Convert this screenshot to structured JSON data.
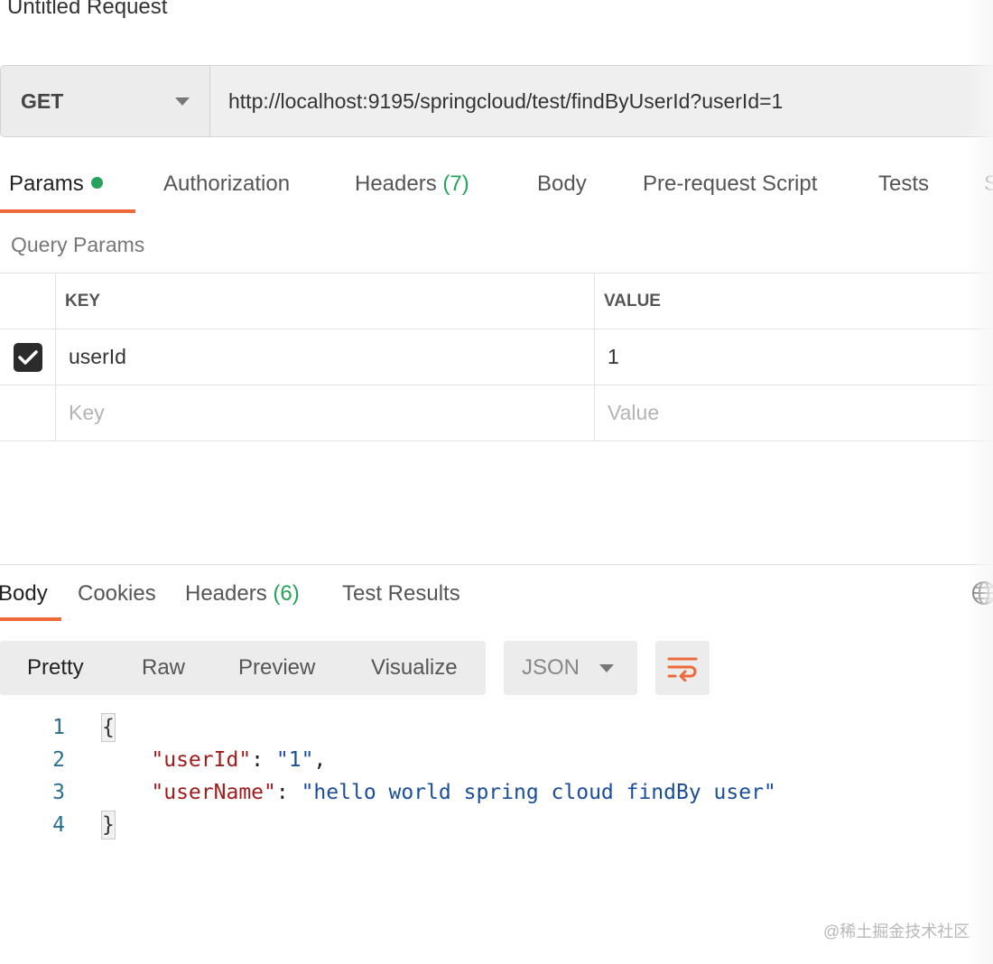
{
  "request": {
    "title": "Untitled Request",
    "method": "GET",
    "url": "http://localhost:9195/springcloud/test/findByUserId?userId=1"
  },
  "request_tabs": [
    {
      "label": "Params",
      "active": true,
      "has_dot": true
    },
    {
      "label": "Authorization"
    },
    {
      "label": "Headers",
      "count": "(7)"
    },
    {
      "label": "Body"
    },
    {
      "label": "Pre-request Script"
    },
    {
      "label": "Tests"
    },
    {
      "label": "S"
    }
  ],
  "query_params": {
    "label": "Query Params",
    "headers": {
      "key": "KEY",
      "value": "VALUE"
    },
    "rows": [
      {
        "checked": true,
        "key": "userId",
        "value": "1"
      }
    ],
    "placeholder": {
      "key": "Key",
      "value": "Value"
    }
  },
  "response_tabs": [
    {
      "label": "Body",
      "active": true
    },
    {
      "label": "Cookies"
    },
    {
      "label": "Headers",
      "count": "(6)"
    },
    {
      "label": "Test Results"
    }
  ],
  "response_format": {
    "modes": [
      "Pretty",
      "Raw",
      "Preview",
      "Visualize"
    ],
    "active_mode": "Pretty",
    "language": "JSON"
  },
  "response_body": {
    "line_numbers": [
      "1",
      "2",
      "3",
      "4"
    ],
    "open_brace": "{",
    "close_brace": "}",
    "fields": [
      {
        "key": "\"userId\"",
        "value": "\"1\"",
        "trailing": ","
      },
      {
        "key": "\"userName\"",
        "value": "\"hello world spring cloud findBy user\"",
        "trailing": ""
      }
    ]
  },
  "colors": {
    "accent": "#ee6a3a",
    "success": "#26a35a"
  },
  "watermark": "@稀土掘金技术社区"
}
